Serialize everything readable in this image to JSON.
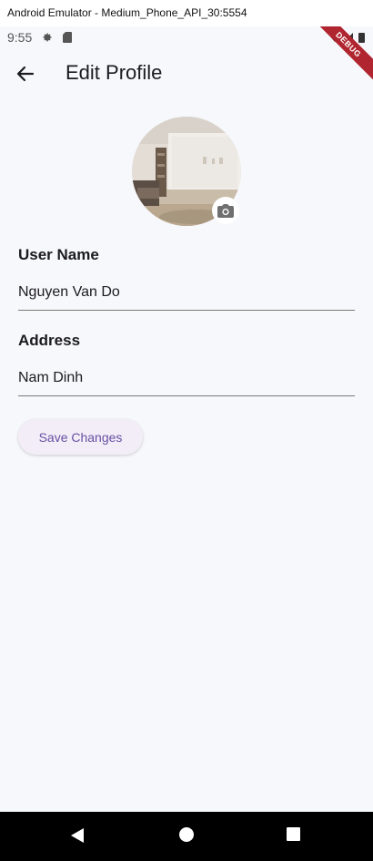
{
  "window": {
    "title": "Android Emulator - Medium_Phone_API_30:5554"
  },
  "status_bar": {
    "time": "9:55"
  },
  "debug_banner": {
    "label": "DEBUG"
  },
  "app_bar": {
    "title": "Edit Profile"
  },
  "profile": {
    "user_name_label": "User Name",
    "user_name_value": "Nguyen Van Do",
    "address_label": "Address",
    "address_value": "Nam Dinh"
  },
  "actions": {
    "save_label": "Save Changes"
  },
  "colors": {
    "accent": "#6750a4",
    "button_bg": "#f3edf7",
    "background": "#f7f8fb"
  },
  "icons": [
    "arrow-back-icon",
    "camera-icon",
    "gear-icon",
    "sd-card-icon",
    "wifi-icon",
    "signal-icon",
    "battery-icon"
  ]
}
